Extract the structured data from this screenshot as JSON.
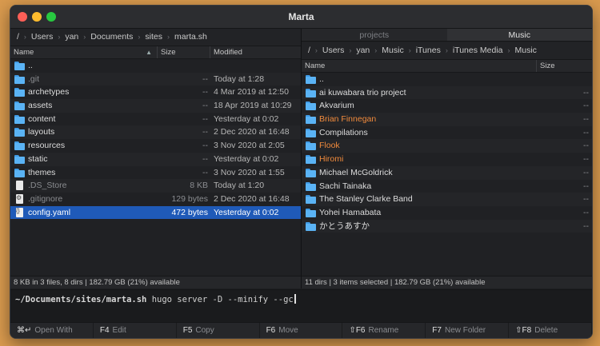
{
  "window": {
    "title": "Marta"
  },
  "left": {
    "breadcrumb": [
      "/",
      "Users",
      "yan",
      "Documents",
      "sites",
      "marta.sh"
    ],
    "columns": {
      "name": "Name",
      "size": "Size",
      "modified": "Modified"
    },
    "rows": [
      {
        "name": "..",
        "size": "",
        "modified": "",
        "type": "folder",
        "dim": false,
        "selected": false
      },
      {
        "name": ".git",
        "size": "--",
        "modified": "Today at 1:28",
        "type": "folder",
        "dim": true,
        "selected": false
      },
      {
        "name": "archetypes",
        "size": "--",
        "modified": "4 Mar 2019 at 12:50",
        "type": "folder",
        "dim": false,
        "selected": false
      },
      {
        "name": "assets",
        "size": "--",
        "modified": "18 Apr 2019 at 10:29",
        "type": "folder",
        "dim": false,
        "selected": false
      },
      {
        "name": "content",
        "size": "--",
        "modified": "Yesterday at 0:02",
        "type": "folder",
        "dim": false,
        "selected": false
      },
      {
        "name": "layouts",
        "size": "--",
        "modified": "2 Dec 2020 at 16:48",
        "type": "folder",
        "dim": false,
        "selected": false
      },
      {
        "name": "resources",
        "size": "--",
        "modified": "3 Nov 2020 at 2:05",
        "type": "folder",
        "dim": false,
        "selected": false
      },
      {
        "name": "static",
        "size": "--",
        "modified": "Yesterday at 0:02",
        "type": "folder",
        "dim": false,
        "selected": false
      },
      {
        "name": "themes",
        "size": "--",
        "modified": "3 Nov 2020 at 1:55",
        "type": "folder",
        "dim": false,
        "selected": false
      },
      {
        "name": ".DS_Store",
        "size": "8 KB",
        "modified": "Today at 1:20",
        "type": "file",
        "dim": true,
        "selected": false
      },
      {
        "name": ".gitignore",
        "size": "129 bytes",
        "modified": "2 Dec 2020 at 16:48",
        "type": "gear",
        "dim": true,
        "selected": false
      },
      {
        "name": "config.yaml",
        "size": "472 bytes",
        "modified": "Yesterday at 0:02",
        "type": "yaml",
        "dim": false,
        "selected": true
      }
    ],
    "status": "8 KB in 3 files, 8 dirs  |  182.79 GB (21%) available"
  },
  "right": {
    "tabs": [
      {
        "label": "projects",
        "active": false
      },
      {
        "label": "Music",
        "active": true
      }
    ],
    "breadcrumb": [
      "/",
      "Users",
      "yan",
      "Music",
      "iTunes",
      "iTunes Media",
      "Music"
    ],
    "columns": {
      "name": "Name",
      "size": "Size"
    },
    "rows": [
      {
        "name": "..",
        "size": "",
        "highlight": false
      },
      {
        "name": "ai kuwabara trio project",
        "size": "--",
        "highlight": false
      },
      {
        "name": "Akvarium",
        "size": "--",
        "highlight": false
      },
      {
        "name": "Brian Finnegan",
        "size": "--",
        "highlight": true
      },
      {
        "name": "Compilations",
        "size": "--",
        "highlight": false
      },
      {
        "name": "Flook",
        "size": "--",
        "highlight": true
      },
      {
        "name": "Hiromi",
        "size": "--",
        "highlight": true
      },
      {
        "name": "Michael McGoldrick",
        "size": "--",
        "highlight": false
      },
      {
        "name": "Sachi Tainaka",
        "size": "--",
        "highlight": false
      },
      {
        "name": "The Stanley Clarke Band",
        "size": "--",
        "highlight": false
      },
      {
        "name": "Yohei Hamabata",
        "size": "--",
        "highlight": false
      },
      {
        "name": "かとうあすか",
        "size": "--",
        "highlight": false
      }
    ],
    "status": "11 dirs  |  3 items selected  |  182.79 GB (21%) available"
  },
  "console": {
    "path": "~/Documents/sites/marta.sh",
    "command": "hugo server -D --minify --gc"
  },
  "fkeys": [
    {
      "key": "⌘↵",
      "label": "Open With"
    },
    {
      "key": "F4",
      "label": "Edit"
    },
    {
      "key": "F5",
      "label": "Copy"
    },
    {
      "key": "F6",
      "label": "Move"
    },
    {
      "key": "⇧F6",
      "label": "Rename"
    },
    {
      "key": "F7",
      "label": "New Folder"
    },
    {
      "key": "⇧F8",
      "label": "Delete"
    }
  ],
  "colors": {
    "selection": "#1f5ab8",
    "highlight": "#f08a3c",
    "folder": "#5ab3f5"
  }
}
